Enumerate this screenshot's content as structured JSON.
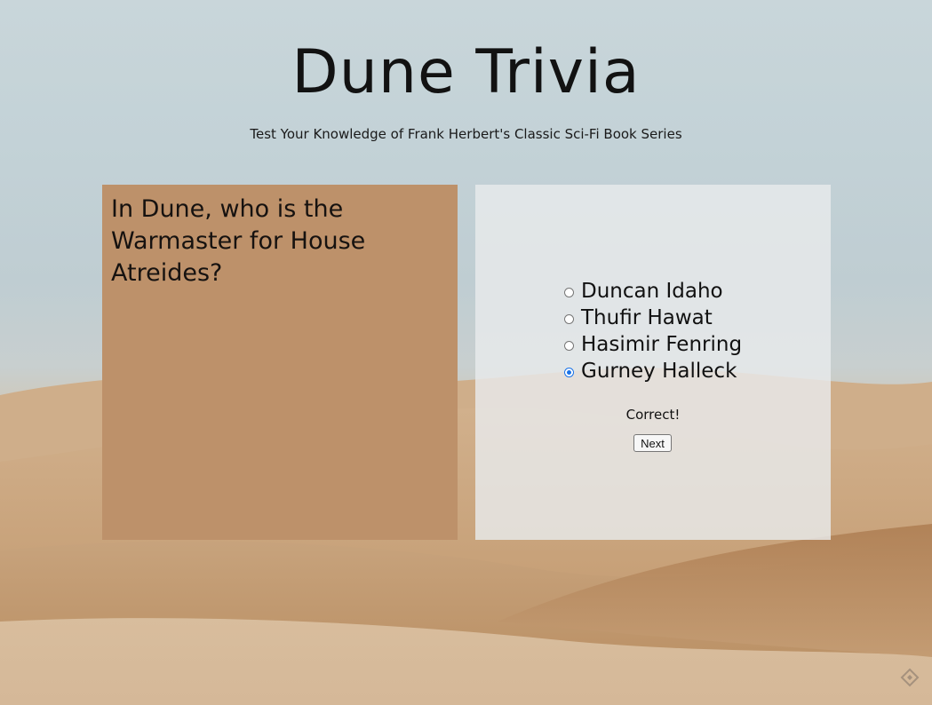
{
  "page": {
    "title": "Dune Trivia",
    "subtitle": "Test Your Knowledge of Frank Herbert's Classic Sci-Fi Book Series"
  },
  "question": {
    "text": "In Dune, who is the Warmaster for House Atreides?"
  },
  "answers": {
    "options": [
      {
        "label": "Duncan Idaho",
        "selected": false
      },
      {
        "label": "Thufir Hawat",
        "selected": false
      },
      {
        "label": "Hasimir Fenring",
        "selected": false
      },
      {
        "label": "Gurney Halleck",
        "selected": true
      }
    ],
    "feedback": "Correct!",
    "next_label": "Next"
  },
  "colors": {
    "question_card": "#bd916a",
    "radio_accent": "#1a73e8"
  },
  "icons": {
    "corner": "diamond-logo-icon"
  }
}
